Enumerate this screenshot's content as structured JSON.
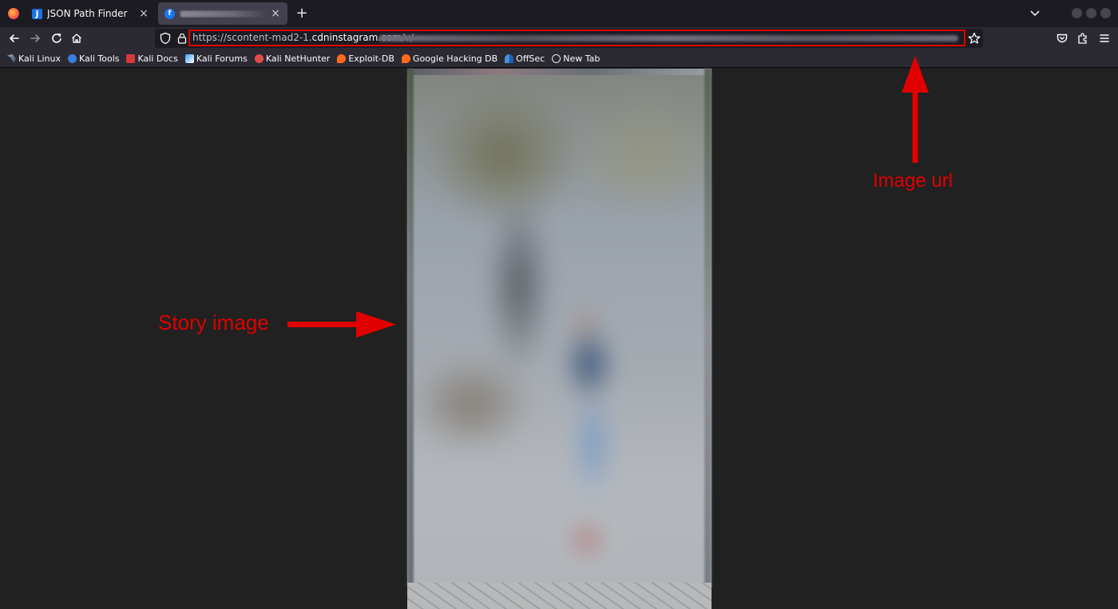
{
  "tabs": [
    {
      "title": "JSON Path Finder",
      "favicon": "json-path-finder-icon",
      "active": false
    },
    {
      "title": "",
      "favicon": "facebook-icon",
      "active": true
    }
  ],
  "tab_close_glyph": "×",
  "new_tab_glyph": "+",
  "address_bar": {
    "url_prefix": "https://scontent-mad2-1.",
    "url_host": "cdninstagram.com",
    "url_suffix": "/v/"
  },
  "bookmarks": [
    {
      "label": "Kali Linux",
      "icon": "kali-linux-icon"
    },
    {
      "label": "Kali Tools",
      "icon": "kali-tools-icon"
    },
    {
      "label": "Kali Docs",
      "icon": "kali-docs-icon"
    },
    {
      "label": "Kali Forums",
      "icon": "kali-forums-icon"
    },
    {
      "label": "Kali NetHunter",
      "icon": "kali-nethunter-icon"
    },
    {
      "label": "Exploit-DB",
      "icon": "exploit-db-icon"
    },
    {
      "label": "Google Hacking DB",
      "icon": "google-hacking-db-icon"
    },
    {
      "label": "OffSec",
      "icon": "offsec-icon"
    },
    {
      "label": "New Tab",
      "icon": "globe-icon"
    }
  ],
  "annotations": {
    "story_label": "Story image",
    "url_label": "Image url",
    "color": "#e00000"
  },
  "colors": {
    "chrome_dark": "#1c1b22",
    "toolbar": "#2b2a33",
    "page_background": "#212121",
    "active_tab": "#42414d"
  }
}
